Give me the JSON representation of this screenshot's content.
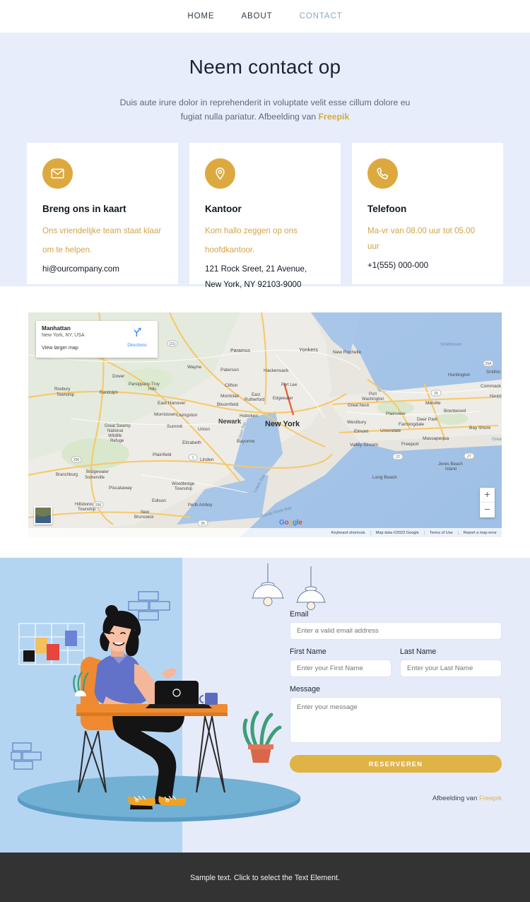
{
  "nav": {
    "items": [
      {
        "label": "HOME",
        "active": false
      },
      {
        "label": "ABOUT",
        "active": false
      },
      {
        "label": "CONTACT",
        "active": true
      }
    ]
  },
  "hero": {
    "title": "Neem contact op",
    "subtitle_text": "Duis aute irure dolor in reprehenderit in voluptate velit esse cillum dolore eu fugiat nulla pariatur. Afbeelding van ",
    "subtitle_brand": "Freepik"
  },
  "cards": [
    {
      "icon": "envelope-icon",
      "title": "Breng ons in kaart",
      "gold_line1": "Ons vriendelijke team staat klaar",
      "gold_line2": "om te helpen.",
      "dark_line1": "hi@ourcompany.com",
      "dark_line2": ""
    },
    {
      "icon": "map-pin-icon",
      "title": "Kantoor",
      "gold_line1": "Kom hallo zeggen op ons",
      "gold_line2": "hoofdkantoor.",
      "dark_line1": "121 Rock Sreet, 21 Avenue,",
      "dark_line2": "New York, NY 92103-9000"
    },
    {
      "icon": "phone-icon",
      "title": "Telefoon",
      "gold_line1": "Ma-vr van 08.00 uur tot 05.00 uur",
      "gold_line2": "",
      "dark_line1": "+1(555) 000-000",
      "dark_line2": ""
    }
  ],
  "map": {
    "place_title": "Manhattan",
    "place_subtitle": "New York, NY, USA",
    "view_larger": "View larger map",
    "directions_label": "Directions",
    "zoom_in": "+",
    "zoom_out": "−",
    "attribution": [
      "Keyboard shortcuts",
      "Map data ©2023 Google",
      "Terms of Use",
      "Report a map error"
    ],
    "logo": "Google",
    "labels": [
      "Paramus",
      "Yonkers",
      "New Rochelle",
      "Smithtown",
      "Wayne",
      "Paterson",
      "Hackensack",
      "Huntington",
      "Commack",
      "Hauppauge",
      "Dover",
      "Parsippany-Troy Hills",
      "Clifton",
      "Fort Lee",
      "Great Neck",
      "Smithto",
      "Roxbury Township",
      "Randolph",
      "Montclair",
      "East Rutherford",
      "Edgewater",
      "Port Washington",
      "Bloomfield",
      "Melville",
      "Brentwood",
      "East Hanover",
      "Morristown",
      "Livingston",
      "Hoboken",
      "Plainview",
      "Deer Park",
      "Newark",
      "New York",
      "Westbury",
      "Farmingdale",
      "Great Swamp National Wildlife Refuge",
      "Summit",
      "Union",
      "Elmont",
      "Uniondale",
      "Bay Shore",
      "Elizabeth",
      "Bayonne",
      "Massapequa",
      "Valley Stream",
      "Freeport",
      "Great S",
      "Plainfield",
      "Linden",
      "Branchburg",
      "Bridgewater",
      "Somerville",
      "Jones Beach Island",
      "Piscataway",
      "Woodbridge Township",
      "Long Beach",
      "Hillsborough Township",
      "Edison",
      "New Brunswick",
      "Perth Amboy",
      "Lower Bay",
      "Upper Bay",
      "Sandy Hook Bay"
    ]
  },
  "form": {
    "email_label": "Email",
    "email_placeholder": "Enter a valid email address",
    "first_name_label": "First Name",
    "first_name_placeholder": "Enter your First Name",
    "last_name_label": "Last Name",
    "last_name_placeholder": "Enter your Last Name",
    "message_label": "Message",
    "message_placeholder": "Enter your message",
    "submit_label": "RESERVEREN",
    "credit_text": "Afbeelding van ",
    "credit_brand": "Freepik"
  },
  "footer": {
    "text": "Sample text. Click to select the Text Element."
  },
  "colors": {
    "accent_gold": "#dda93f",
    "gold_text": "#d3a348",
    "hero_bg": "#e7edfa",
    "illo_left_bg": "#b4d5f2",
    "illo_right_bg": "#e5ebf9",
    "footer_bg": "#333333",
    "nav_active": "#8aa8c4"
  }
}
